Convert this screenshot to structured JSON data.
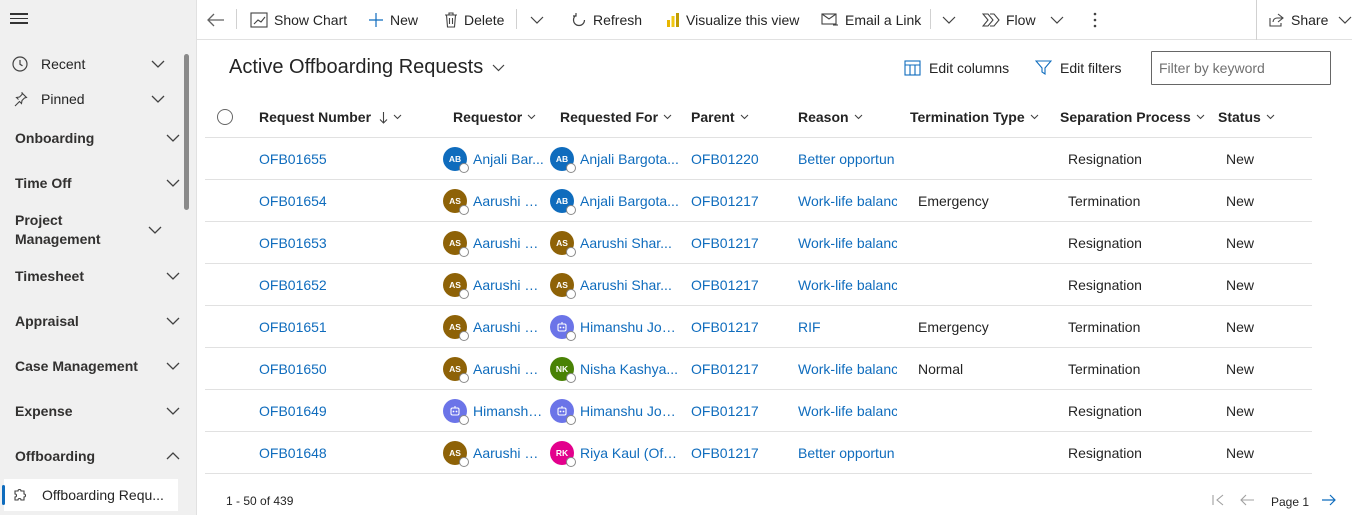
{
  "toolbar": {
    "show_chart": "Show Chart",
    "new": "New",
    "delete": "Delete",
    "refresh": "Refresh",
    "visualize": "Visualize this view",
    "email_link": "Email a Link",
    "flow": "Flow",
    "share": "Share"
  },
  "sidebar": {
    "recent": "Recent",
    "pinned": "Pinned",
    "groups": [
      {
        "label": "Onboarding"
      },
      {
        "label": "Time Off"
      },
      {
        "label": "Project Management"
      },
      {
        "label": "Timesheet"
      },
      {
        "label": "Appraisal"
      },
      {
        "label": "Case Management"
      },
      {
        "label": "Expense"
      },
      {
        "label": "Offboarding"
      }
    ],
    "active_item": "Offboarding Requ..."
  },
  "header": {
    "title": "Active Offboarding Requests",
    "edit_columns": "Edit columns",
    "edit_filters": "Edit filters",
    "filter_placeholder": "Filter by keyword"
  },
  "columns": [
    "Request Number",
    "Requestor",
    "Requested For",
    "Parent",
    "Reason",
    "Termination Type",
    "Separation Process",
    "Status"
  ],
  "rows": [
    {
      "number": "OFB01655",
      "requestor": {
        "initials": "AB",
        "color": "#0f6cbd",
        "name": "Anjali Bar..."
      },
      "requested_for": {
        "initials": "AB",
        "color": "#0f6cbd",
        "name": "Anjali Bargota..."
      },
      "parent": "OFB01220",
      "reason": "Better opportun",
      "termination": "",
      "separation": "Resignation",
      "status": "New"
    },
    {
      "number": "OFB01654",
      "requestor": {
        "initials": "AS",
        "color": "#8e6207",
        "name": "Aarushi S..."
      },
      "requested_for": {
        "initials": "AB",
        "color": "#0f6cbd",
        "name": "Anjali Bargota..."
      },
      "parent": "OFB01217",
      "reason": "Work-life balanc",
      "termination": "Emergency",
      "separation": "Termination",
      "status": "New"
    },
    {
      "number": "OFB01653",
      "requestor": {
        "initials": "AS",
        "color": "#8e6207",
        "name": "Aarushi S..."
      },
      "requested_for": {
        "initials": "AS",
        "color": "#8e6207",
        "name": "Aarushi Shar..."
      },
      "parent": "OFB01217",
      "reason": "Work-life balanc",
      "termination": "",
      "separation": "Resignation",
      "status": "New"
    },
    {
      "number": "OFB01652",
      "requestor": {
        "initials": "AS",
        "color": "#8e6207",
        "name": "Aarushi S..."
      },
      "requested_for": {
        "initials": "AS",
        "color": "#8e6207",
        "name": "Aarushi Shar..."
      },
      "parent": "OFB01217",
      "reason": "Work-life balanc",
      "termination": "",
      "separation": "Resignation",
      "status": "New"
    },
    {
      "number": "OFB01651",
      "requestor": {
        "initials": "AS",
        "color": "#8e6207",
        "name": "Aarushi S..."
      },
      "requested_for": {
        "initials": "",
        "color": "#6b74e8",
        "name": "Himanshu Jos...",
        "bot": true
      },
      "parent": "OFB01217",
      "reason": "RIF",
      "termination": "Emergency",
      "separation": "Termination",
      "status": "New"
    },
    {
      "number": "OFB01650",
      "requestor": {
        "initials": "AS",
        "color": "#8e6207",
        "name": "Aarushi S..."
      },
      "requested_for": {
        "initials": "NK",
        "color": "#498205",
        "name": "Nisha Kashya..."
      },
      "parent": "OFB01217",
      "reason": "Work-life balanc",
      "termination": "Normal",
      "separation": "Termination",
      "status": "New"
    },
    {
      "number": "OFB01649",
      "requestor": {
        "initials": "",
        "color": "#6b74e8",
        "name": "Himanshu...",
        "bot": true
      },
      "requested_for": {
        "initials": "",
        "color": "#6b74e8",
        "name": "Himanshu Jos...",
        "bot": true
      },
      "parent": "OFB01217",
      "reason": "Work-life balanc",
      "termination": "",
      "separation": "Resignation",
      "status": "New"
    },
    {
      "number": "OFB01648",
      "requestor": {
        "initials": "AS",
        "color": "#8e6207",
        "name": "Aarushi S..."
      },
      "requested_for": {
        "initials": "RK",
        "color": "#e3008c",
        "name": "Riya Kaul (Offl..."
      },
      "parent": "OFB01217",
      "reason": "Better opportun",
      "termination": "",
      "separation": "Resignation",
      "status": "New"
    }
  ],
  "footer": {
    "count": "1 - 50 of 439",
    "page": "Page 1"
  }
}
